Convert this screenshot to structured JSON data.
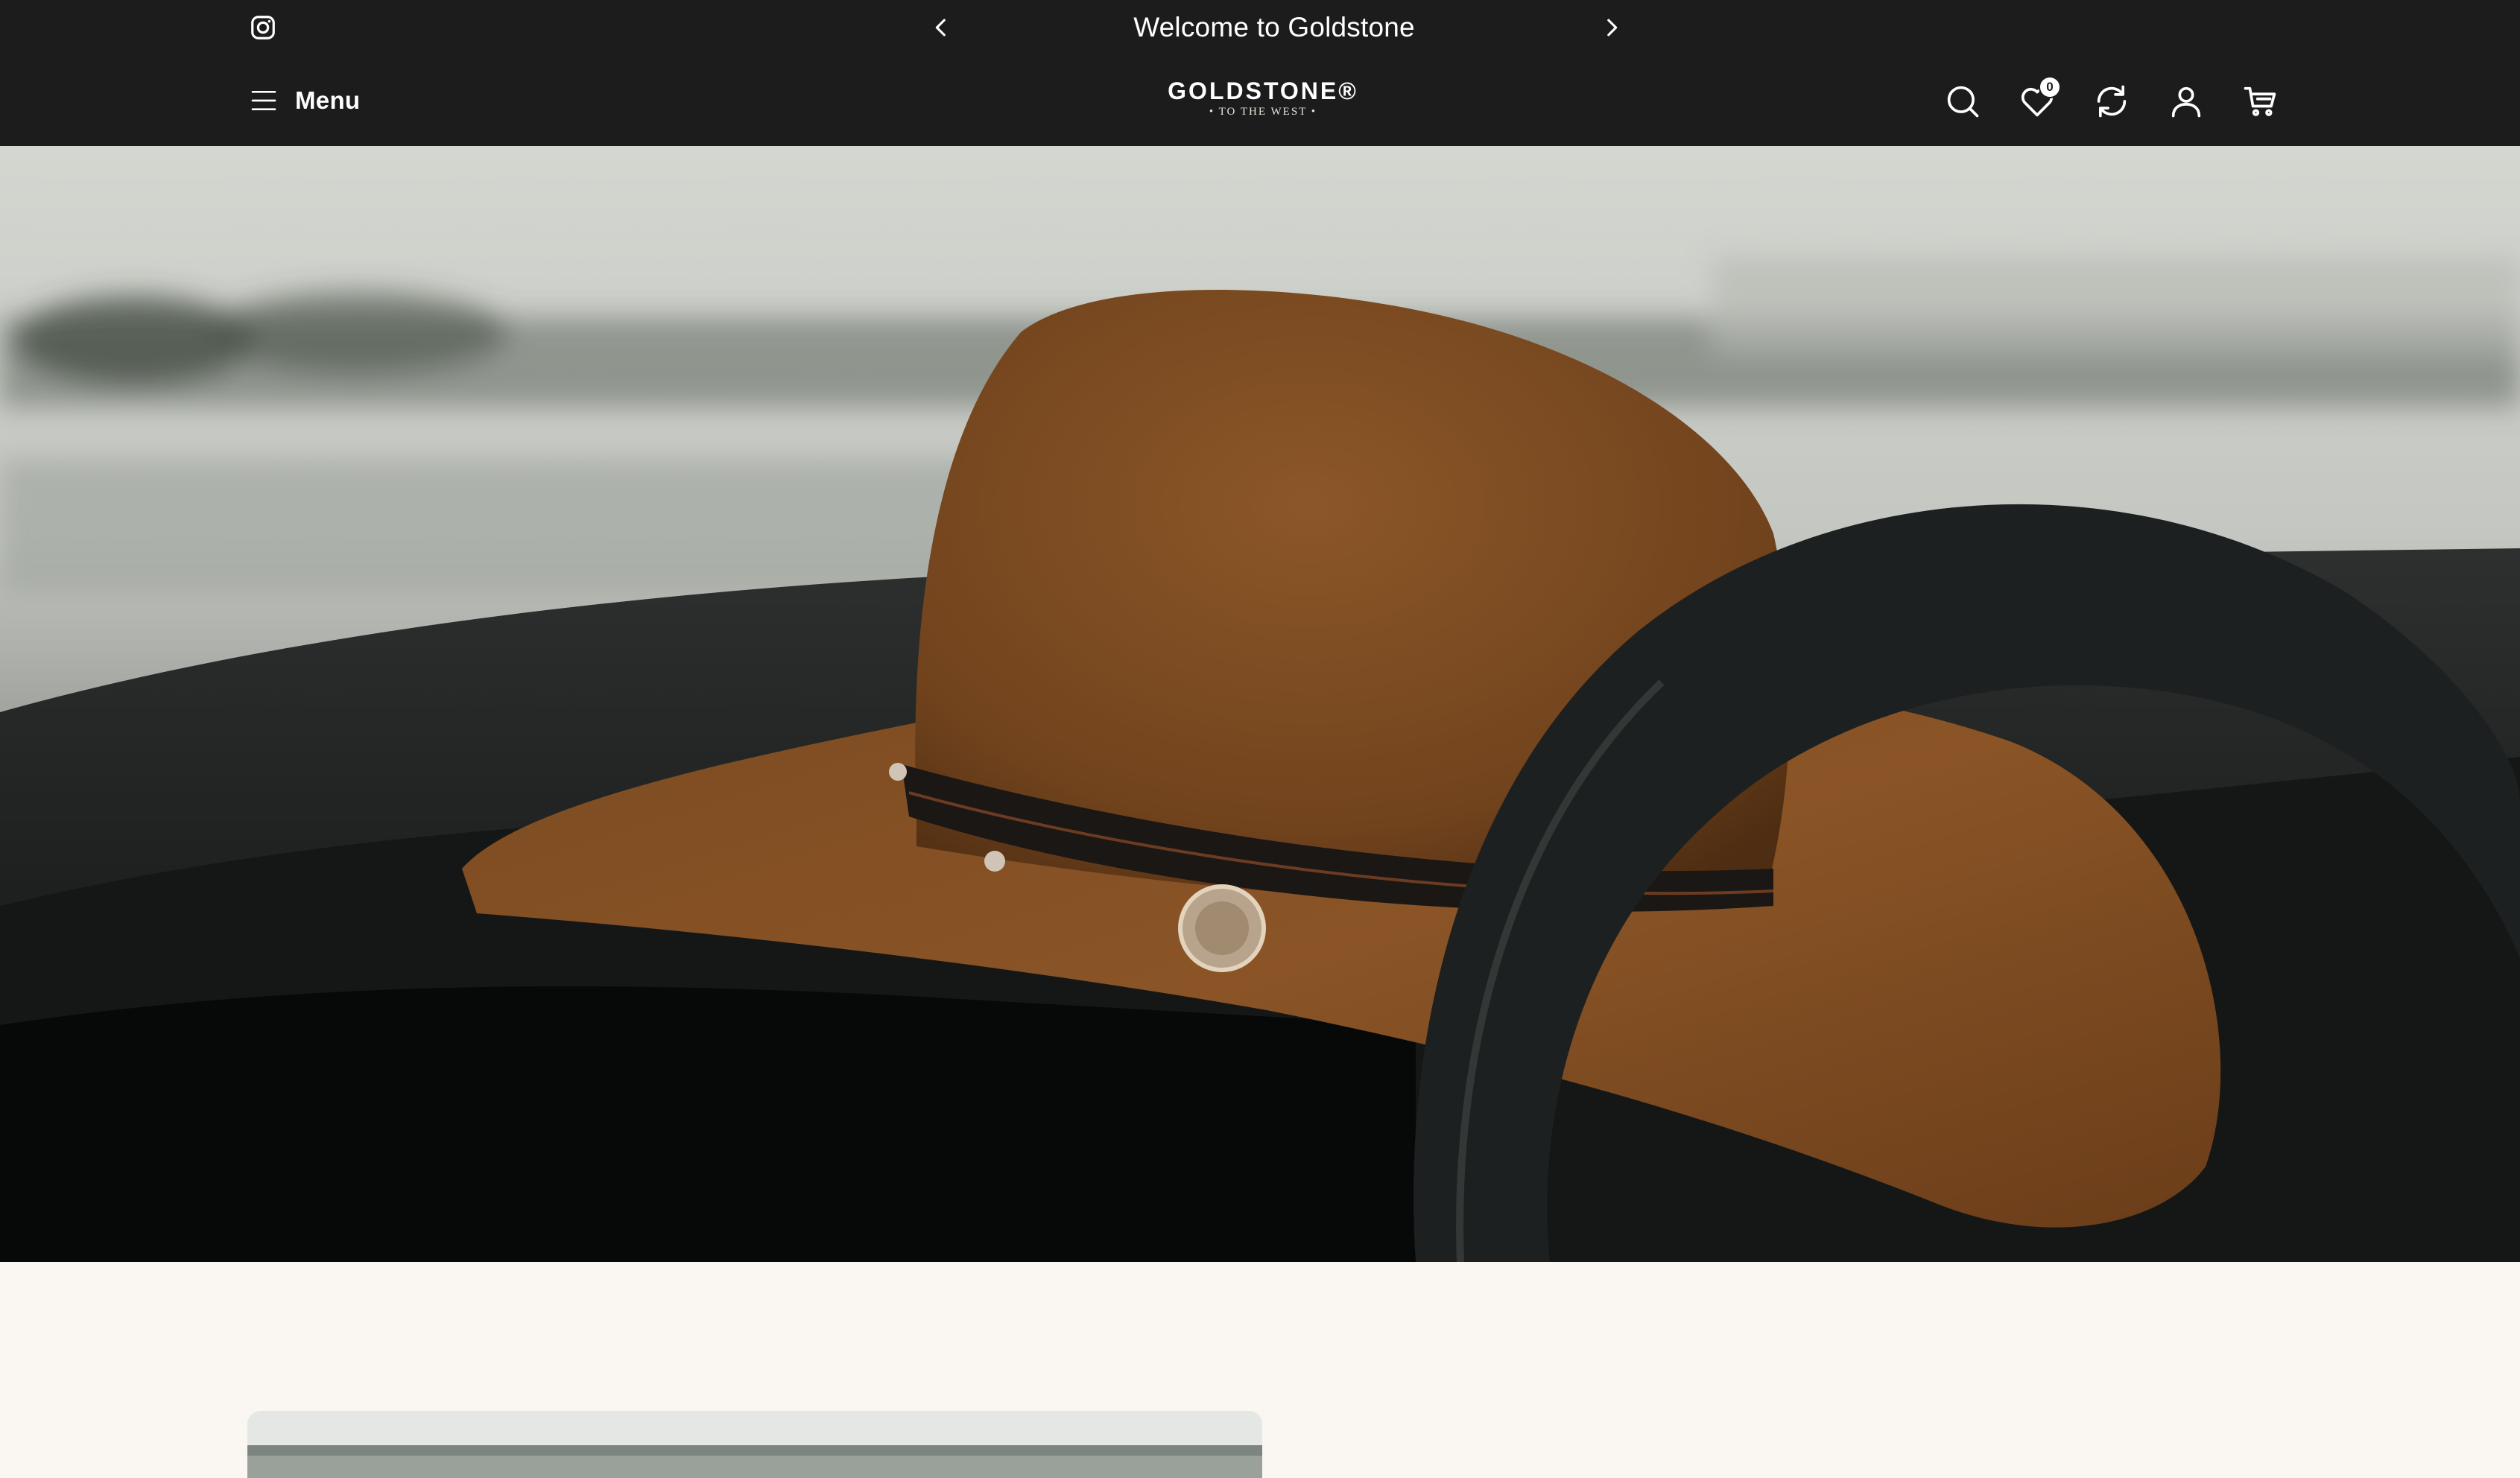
{
  "announcement": {
    "message": "Welcome to Goldstone",
    "prev_icon": "chevron-left-icon",
    "next_icon": "chevron-right-icon",
    "social_icon": "instagram-icon"
  },
  "header": {
    "menu_label": "Menu",
    "menu_icon": "hamburger-icon",
    "logo_wordmark": "GOLDSTONE®",
    "logo_tagline": "• TO THE WEST •",
    "icons": [
      "search-icon",
      "wishlist-heart-icon",
      "compare-refresh-icon",
      "account-icon",
      "cart-icon"
    ],
    "wishlist_count": "0"
  },
  "hero": {
    "image": "brown-felt-cowboy-hat-on-car-dashboard",
    "colors": {
      "hat": "#7a4a22",
      "dashboard": "#1f2221",
      "sky": "#cfd2cc"
    }
  },
  "colors": {
    "bar_background": "#1c1c1c",
    "page_background": "#faf7f2",
    "text_light": "#ffffff"
  }
}
